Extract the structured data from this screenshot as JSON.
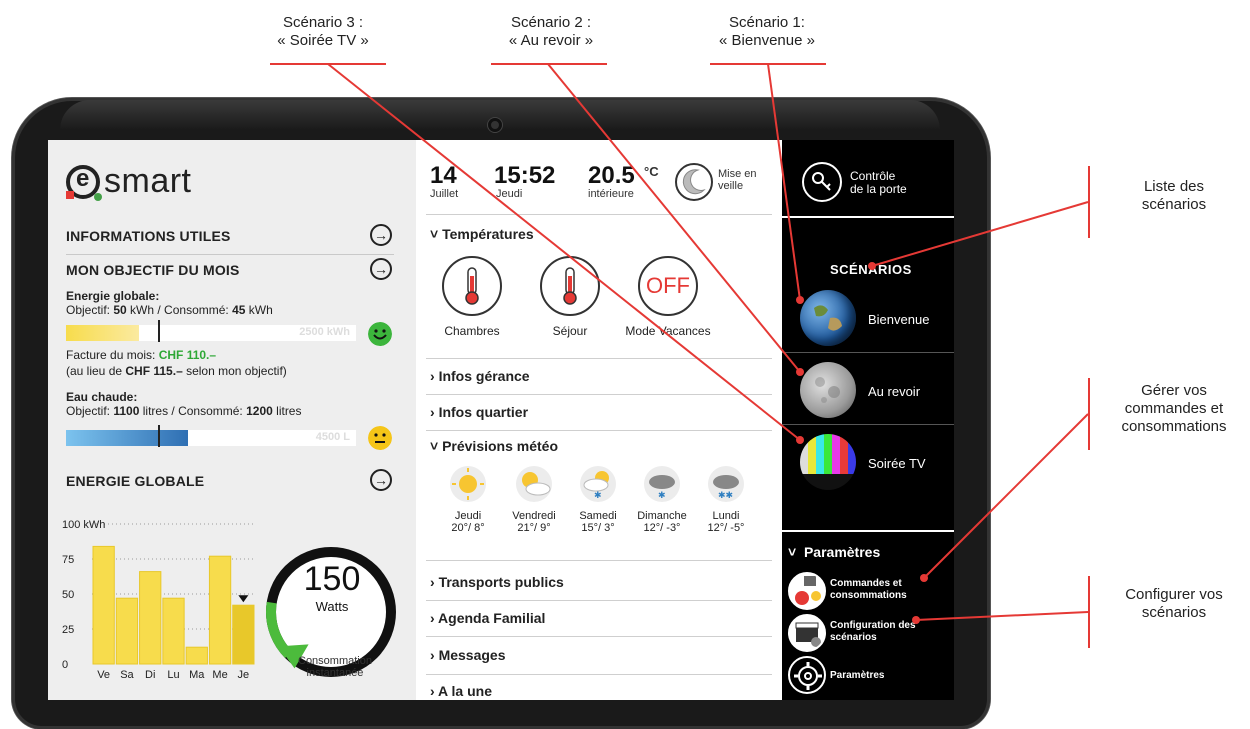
{
  "annotations": {
    "scenario3_line1": "Scénario 3 :",
    "scenario3_line2": "« Soirée TV »",
    "scenario2_line1": "Scénario 2 :",
    "scenario2_line2": "« Au revoir »",
    "scenario1_line1": "Scénario 1:",
    "scenario1_line2": "« Bienvenue »",
    "list_line1": "Liste des",
    "list_line2": "scénarios",
    "manage_line1": "Gérer vos",
    "manage_line2": "commandes et",
    "manage_line3": "consommations",
    "config_line1": "Configurer vos",
    "config_line2": "scénarios"
  },
  "left": {
    "logo": "smart",
    "info_utiles": "INFORMATIONS UTILES",
    "objectif_title": "MON OBJECTIF DU MOIS",
    "energie_label": "Energie globale:",
    "energie_obj_prefix": "Objectif: ",
    "energie_obj_value": "50",
    "energie_obj_unit": " kWh / Consommé: ",
    "energie_cons_value": "45",
    "energie_cons_unit": " kWh",
    "energie_bar_max": "2500 kWh",
    "energie_bar_fill_fraction": 0.25,
    "facture_prefix": "Facture du mois: ",
    "facture_value": "CHF 110.–",
    "facture_note_prefix": "(au lieu de ",
    "facture_note_value": "CHF 115.–",
    "facture_note_suffix": " selon mon objectif)",
    "eau_label": "Eau chaude:",
    "eau_obj_prefix": "Objectif: ",
    "eau_obj_value": "1100",
    "eau_obj_unit": " litres / Consommé: ",
    "eau_cons_value": "1200",
    "eau_cons_unit": " litres",
    "eau_bar_max": "4500 L",
    "eau_bar_fill_fraction": 0.42,
    "energie_globale": "ENERGIE GLOBALE",
    "gauge_value": "150",
    "gauge_unit": "Watts",
    "gauge_caption_line1": "Consommation",
    "gauge_caption_line2": "instantanée",
    "gauge_fill_fraction": 0.2
  },
  "chart_data": {
    "type": "bar",
    "categories": [
      "Ve",
      "Sa",
      "Di",
      "Lu",
      "Ma",
      "Me",
      "Je"
    ],
    "values": [
      84,
      47,
      66,
      47,
      12,
      77,
      42
    ],
    "ylabel": "kWh",
    "ylim": [
      0,
      100
    ],
    "yticks": [
      0,
      25,
      50,
      75,
      100
    ],
    "ytick_labels": [
      "0",
      "25",
      "50",
      "75",
      "100 kWh"
    ],
    "grid": true,
    "colors": {
      "bar": "#f7dc4c",
      "highlight": "#e8c82a"
    }
  },
  "middle": {
    "day": "14",
    "month": "Juillet",
    "time": "15:52",
    "weekday": "Jeudi",
    "temp": "20.5",
    "temp_unit": "°C",
    "temp_label": "intérieure",
    "sleep_line1": "Mise en",
    "sleep_line2": "veille",
    "temperatures": "Températures",
    "chambres": "Chambres",
    "sejour": "Séjour",
    "off_label": "OFF",
    "vacances": "Mode Vacances",
    "infos_gerance": "Infos gérance",
    "infos_quartier": "Infos quartier",
    "previsions": "Prévisions météo",
    "weather": [
      {
        "day": "Jeudi",
        "temp": "20°/ 8°",
        "icon": "sun-icon"
      },
      {
        "day": "Vendredi",
        "temp": "21°/ 9°",
        "icon": "partly-cloudy-icon"
      },
      {
        "day": "Samedi",
        "temp": "15°/ 3°",
        "icon": "sun-snow-icon"
      },
      {
        "day": "Dimanche",
        "temp": "12°/ -3°",
        "icon": "snow-cloud-icon"
      },
      {
        "day": "Lundi",
        "temp": "12°/ -5°",
        "icon": "snow-cloud-icon"
      }
    ],
    "transports": "Transports publics",
    "agenda": "Agenda Familial",
    "messages": "Messages",
    "a_la_une": "A la une"
  },
  "right": {
    "door_line1": "Contrôle",
    "door_line2": "de la porte",
    "scenarios_title": "SCÉNARIOS",
    "bienvenue": "Bienvenue",
    "au_revoir": "Au revoir",
    "soiree_tv": "Soirée TV",
    "parametres_title": "Paramètres",
    "cmd_line1": "Commandes et",
    "cmd_line2": "consommations",
    "config_line1": "Configuration des",
    "config_line2": "scénarios",
    "params": "Paramètres"
  },
  "colors": {
    "accent": "#e53935",
    "yellow": "#f7dc4c",
    "blue": "#2f7fc1",
    "green": "#2ea836"
  }
}
